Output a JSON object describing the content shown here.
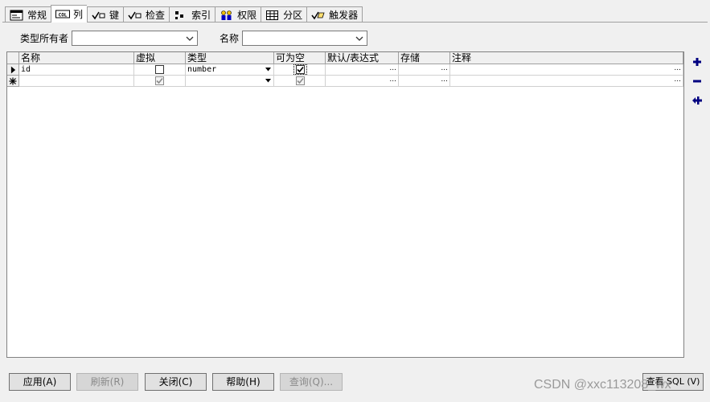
{
  "tabs": [
    {
      "label": "常规",
      "icon": "general-icon"
    },
    {
      "label": "列",
      "icon": "columns-icon",
      "active": true
    },
    {
      "label": "键",
      "icon": "key-icon"
    },
    {
      "label": "检查",
      "icon": "check-icon"
    },
    {
      "label": "索引",
      "icon": "index-icon"
    },
    {
      "label": "权限",
      "icon": "privileges-icon"
    },
    {
      "label": "分区",
      "icon": "partition-icon"
    },
    {
      "label": "触发器",
      "icon": "trigger-icon"
    }
  ],
  "filters": {
    "type_owner_label": "类型所有者",
    "type_owner_value": "",
    "name_label": "名称",
    "name_value": ""
  },
  "grid": {
    "headers": [
      "名称",
      "虚拟",
      "类型",
      "可为空",
      "默认/表达式",
      "存储",
      "注释"
    ],
    "rows": [
      {
        "name": "id",
        "virtual": false,
        "type": "number",
        "nullable": true,
        "default": "",
        "storage": "",
        "comment": "",
        "current": true
      },
      {
        "name": "",
        "virtual": true,
        "type": "",
        "nullable": true,
        "default": "",
        "storage": "",
        "comment": "",
        "new_row": true
      }
    ],
    "ellipsis": "..."
  },
  "side_buttons": [
    {
      "name": "add-column-button",
      "icon": "plus-icon"
    },
    {
      "name": "remove-column-button",
      "icon": "minus-icon"
    },
    {
      "name": "insert-column-button",
      "icon": "insert-icon"
    }
  ],
  "buttons": {
    "apply": "应用(A)",
    "refresh": "刷新(R)",
    "close": "关闭(C)",
    "help": "帮助(H)",
    "query": "查询(Q)...",
    "view_sql": "查看 SQL (V)"
  },
  "watermark": "CSDN @xxc113208_wx",
  "colors": {
    "icon_navy": "#000080"
  }
}
